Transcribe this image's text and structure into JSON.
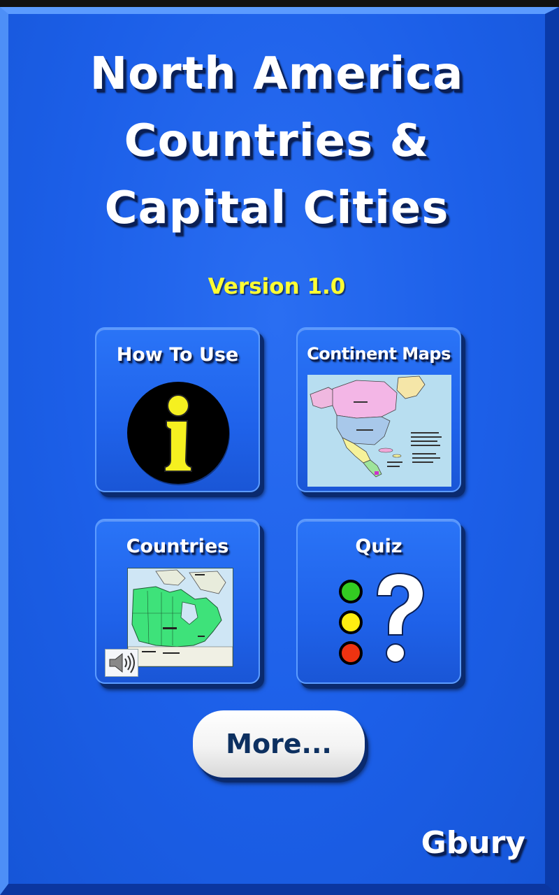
{
  "app": {
    "title_line1": "North America",
    "title_line2": "Countries &",
    "title_line3": "Capital Cities",
    "version": "Version 1.0",
    "brand": "Gbury"
  },
  "tiles": [
    {
      "id": "how-to-use",
      "label": "How To Use",
      "icon": "info-icon"
    },
    {
      "id": "continent-maps",
      "label": "Continent Maps",
      "icon": "north-america-map-thumbnail"
    },
    {
      "id": "countries",
      "label": "Countries",
      "icon": "canada-map-thumbnail"
    },
    {
      "id": "quiz",
      "label": "Quiz",
      "icon": "question-mark-icon"
    }
  ],
  "more_button": {
    "label": "More..."
  },
  "colors": {
    "background": "#1d63ec",
    "version_text": "#ffff33",
    "title_text": "#ffffff",
    "more_text": "#0d3060",
    "quiz_green": "#33cc22",
    "quiz_yellow": "#ffee11",
    "quiz_red": "#ee3311"
  }
}
